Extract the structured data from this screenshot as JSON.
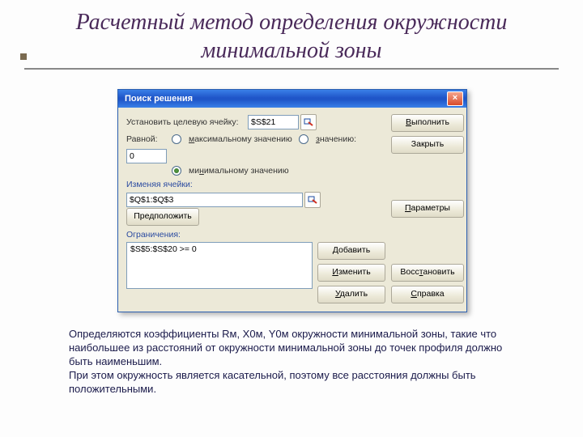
{
  "slide": {
    "title": "Расчетный метод определения окружности минимальной зоны",
    "paragraph1": "Определяются коэффициенты Rм, X0м, Y0м окружности минимальной зоны, такие что наибольшее из расстояний от окружности минимальной зоны до точек профиля должно быть наименьшим.",
    "paragraph2": "При этом окружность является касательной, поэтому все расстояния должны быть положительными."
  },
  "dialog": {
    "title": "Поиск решения",
    "target_label": "Установить целевую ячейку:",
    "target_value": "$S$21",
    "equal_label": "Равной:",
    "opt_max": "максимальному значению",
    "opt_val": "значению:",
    "opt_val_value": "0",
    "opt_min": "минимальному значению",
    "change_label": "Изменяя ячейки:",
    "change_value": "$Q$1:$Q$3",
    "suggest_btn": "Предположить",
    "constraints_label": "Ограничения:",
    "constraints_value": "$S$5:$S$20 >= 0",
    "add_btn": "Добавить",
    "edit_btn": "Изменить",
    "del_btn": "Удалить",
    "run_btn": "Выполнить",
    "close_btn": "Закрыть",
    "params_btn": "Параметры",
    "restore_btn": "Восстановить",
    "help_btn": "Справка"
  }
}
